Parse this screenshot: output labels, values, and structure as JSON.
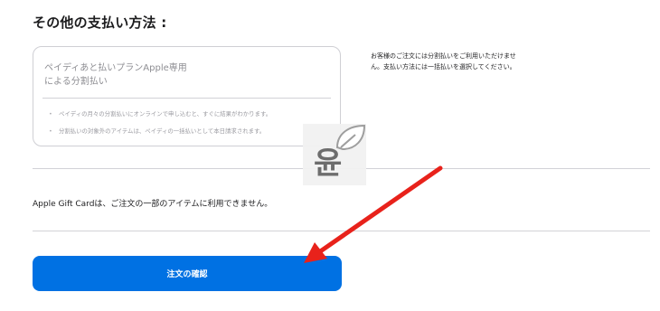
{
  "page": {
    "title": "その他の支払い方法 :"
  },
  "payment_option": {
    "title_line1": "ペイディあと払いプランApple専用",
    "title_line2": "による分割払い",
    "bullets": [
      "ペイディの月々の分割払いにオンラインで申し込むと、すぐに結果がわかります。",
      "分割払いの対象外のアイテムは、ペイディの一括払いとして本日請求されます。"
    ]
  },
  "side_note": {
    "line1": "お客様のご注文には分割払いをご利用いただけませ",
    "line2": "ん。支払い方法には一括払いを選択してください。"
  },
  "gift_card_note": "Apple Gift Cardは、ご注文の一部のアイテムに利用できません。",
  "confirm_button": {
    "label": "注文の確認"
  },
  "watermark": {
    "glyph": "윤",
    "icon": "leaf-icon"
  },
  "annotation": {
    "icon": "arrow-icon",
    "color": "#e8221b"
  },
  "colors": {
    "accent": "#0071e3",
    "divider": "#d2d2d7",
    "muted_text": "#8e8e93"
  }
}
